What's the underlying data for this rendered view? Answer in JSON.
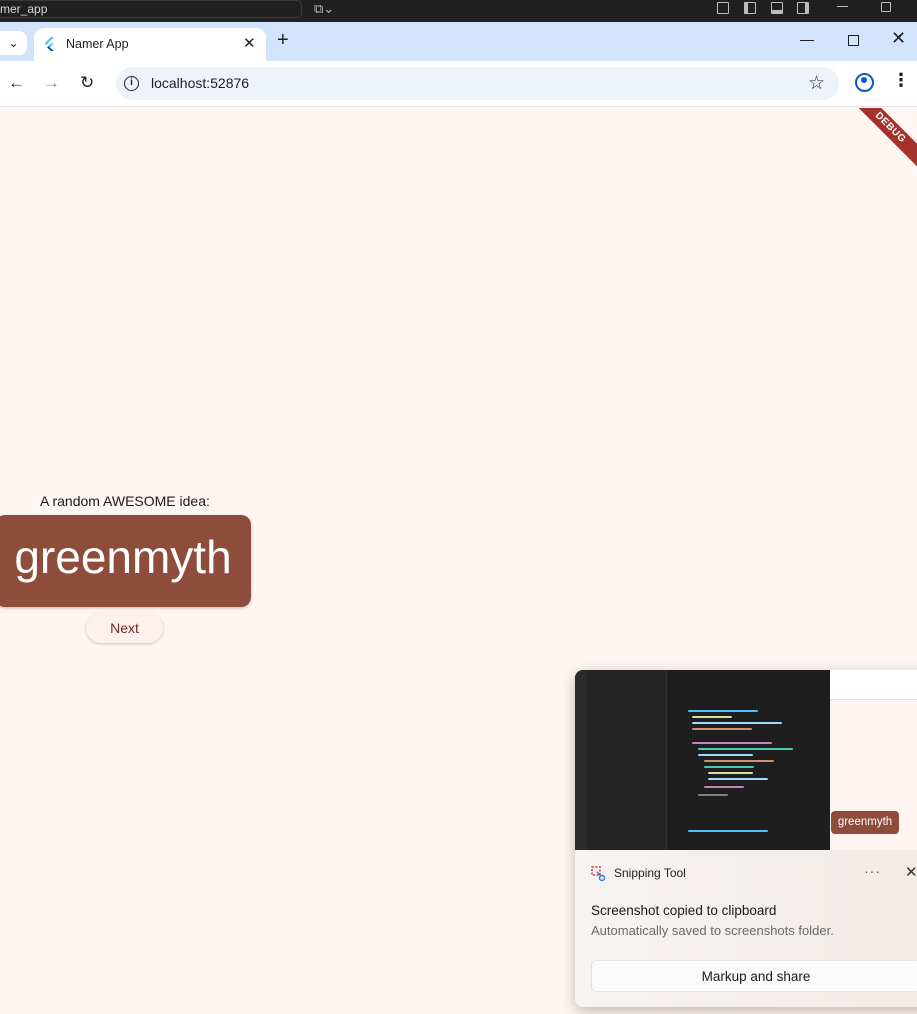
{
  "os": {
    "window_title": "mer_app"
  },
  "browser": {
    "tab": {
      "title": "Namer App"
    },
    "new_tab_label": "+",
    "address": {
      "url": "localhost:52876"
    }
  },
  "page": {
    "debug_banner": "DEBUG",
    "idea_label": "A random AWESOME idea:",
    "idea_word": "greenmyth",
    "next_button": "Next",
    "colors": {
      "background": "#fff5f2",
      "card": "#8e4c3b",
      "button_text": "#6b2e22"
    }
  },
  "snipping_tool": {
    "app_name": "Snipping Tool",
    "more": "···",
    "message": "Screenshot copied to clipboard",
    "sub_message": "Automatically saved to screenshots folder.",
    "action_button": "Markup and share",
    "thumbnail_word": "greenmyth"
  }
}
